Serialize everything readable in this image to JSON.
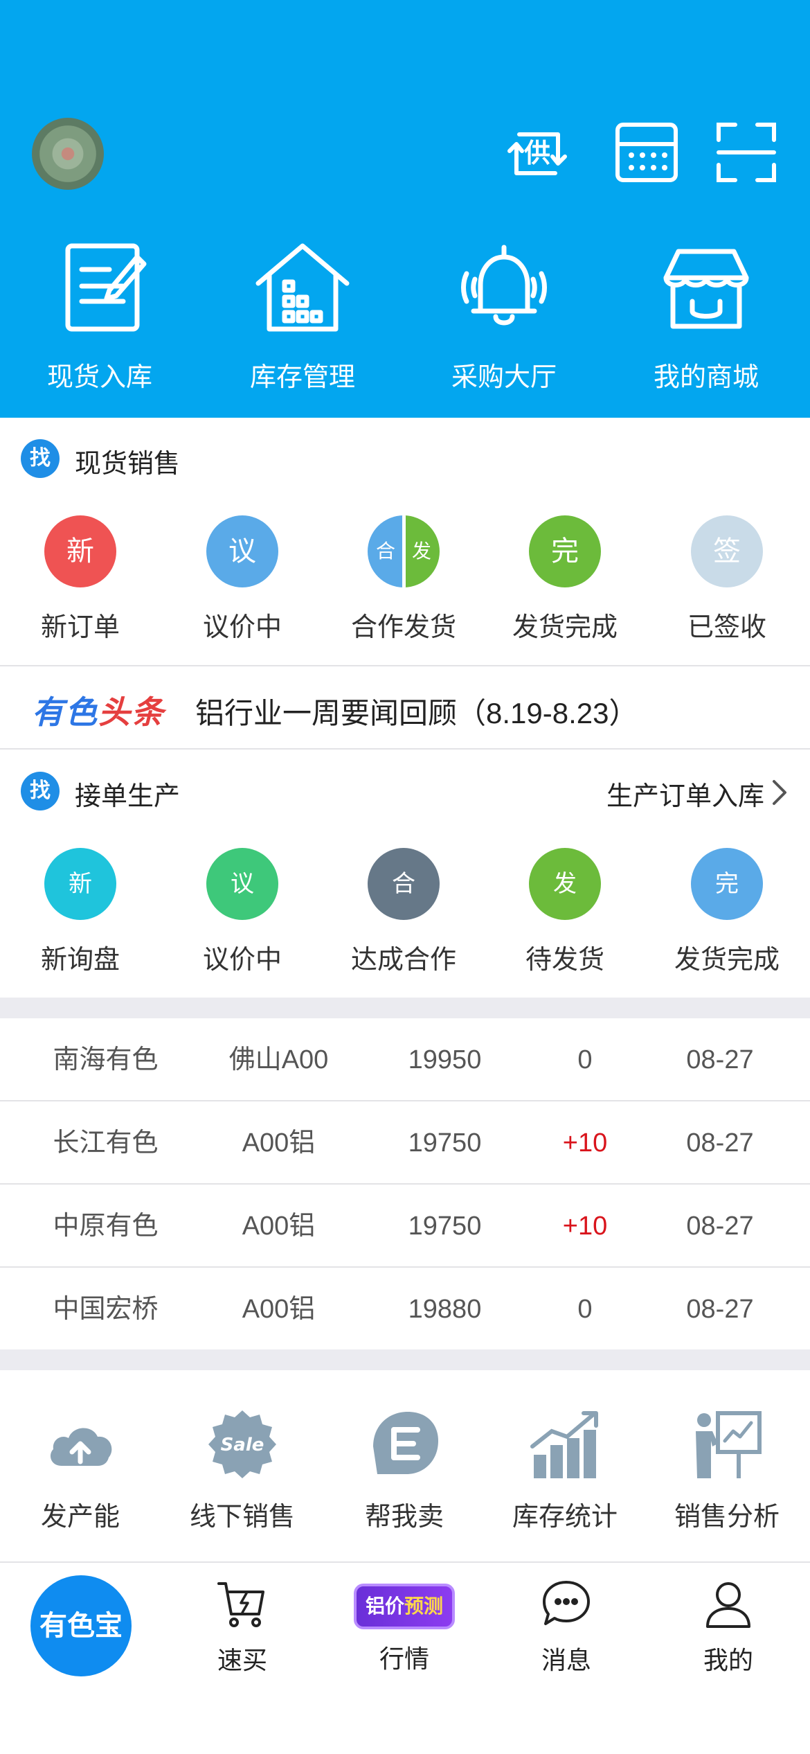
{
  "header": {
    "bg_color": "#03a6ef",
    "top_icons": [
      "supply-icon",
      "calculator-icon",
      "scan-icon"
    ],
    "supply_icon_text": "供",
    "nav": [
      {
        "label": "现货入库",
        "icon": "document-edit-icon"
      },
      {
        "label": "库存管理",
        "icon": "warehouse-icon"
      },
      {
        "label": "采购大厅",
        "icon": "bell-icon"
      },
      {
        "label": "我的商城",
        "icon": "store-icon"
      }
    ]
  },
  "spot_sales": {
    "badge": "找",
    "title": "现货销售",
    "items": [
      {
        "circle": "新",
        "label": "新订单",
        "color": "#ef5353"
      },
      {
        "circle": "议",
        "label": "议价中",
        "color": "#5aaae8"
      },
      {
        "circle_left": "合",
        "circle_right": "发",
        "label": "合作发货",
        "colors": [
          "#5aaae8",
          "#6cbb3b"
        ]
      },
      {
        "circle": "完",
        "label": "发货完成",
        "color": "#6cbb3b"
      },
      {
        "circle": "签",
        "label": "已签收",
        "color": "#c9dbe8"
      }
    ]
  },
  "news": {
    "brand_blue": "有色",
    "brand_red": "头条",
    "text": "铝行业一周要闻回顾（8.19-8.23）"
  },
  "production": {
    "badge": "找",
    "title": "接单生产",
    "link": "生产订单入库",
    "items": [
      {
        "circle": "新",
        "label": "新询盘",
        "color": "#1fc4dc"
      },
      {
        "circle": "议",
        "label": "议价中",
        "color": "#3ec87a"
      },
      {
        "circle": "合",
        "label": "达成合作",
        "color": "#667888"
      },
      {
        "circle": "发",
        "label": "待发货",
        "color": "#6cbb3b"
      },
      {
        "circle": "完",
        "label": "发货完成",
        "color": "#5aaae8"
      }
    ]
  },
  "prices": [
    {
      "market": "南海有色",
      "product": "佛山A00",
      "price": "19950",
      "change": "0",
      "date": "08-27"
    },
    {
      "market": "长江有色",
      "product": "A00铝",
      "price": "19750",
      "change": "+10",
      "date": "08-27"
    },
    {
      "market": "中原有色",
      "product": "A00铝",
      "price": "19750",
      "change": "+10",
      "date": "08-27"
    },
    {
      "market": "中国宏桥",
      "product": "A00铝",
      "price": "19880",
      "change": "0",
      "date": "08-27"
    }
  ],
  "tools": [
    {
      "label": "发产能",
      "icon": "cloud-upload-icon"
    },
    {
      "label": "线下销售",
      "icon": "sale-badge-icon",
      "icon_text": "Sale"
    },
    {
      "label": "帮我卖",
      "icon": "help-sell-icon"
    },
    {
      "label": "库存统计",
      "icon": "bar-chart-icon"
    },
    {
      "label": "销售分析",
      "icon": "presentation-icon"
    }
  ],
  "tabbar": {
    "home": "有色宝",
    "tabs": [
      {
        "label": "速买",
        "icon": "cart-icon"
      },
      {
        "label": "行情",
        "badge_w": "铝价",
        "badge_y": "预测"
      },
      {
        "label": "消息",
        "icon": "chat-icon"
      },
      {
        "label": "我的",
        "icon": "user-icon"
      }
    ]
  }
}
